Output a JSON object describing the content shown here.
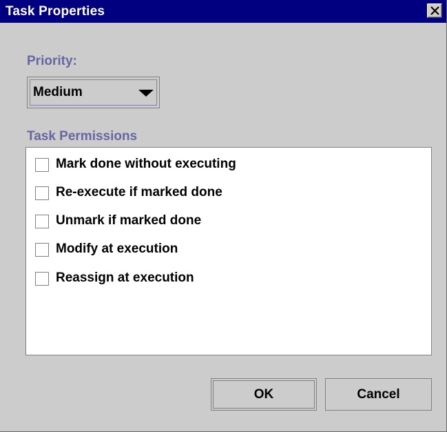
{
  "window": {
    "title": "Task Properties",
    "close_icon": "close-x-icon"
  },
  "priority": {
    "label": "Priority:",
    "selected": "Medium"
  },
  "permissions": {
    "label": "Task Permissions",
    "items": [
      {
        "label": "Mark done without executing",
        "checked": false
      },
      {
        "label": "Re-execute if marked done",
        "checked": false
      },
      {
        "label": "Unmark if marked done",
        "checked": false
      },
      {
        "label": "Modify at execution",
        "checked": false
      },
      {
        "label": "Reassign at execution",
        "checked": false
      }
    ]
  },
  "buttons": {
    "ok": "OK",
    "cancel": "Cancel"
  },
  "colors": {
    "titlebar": "#000080",
    "section_label": "#6666a3",
    "dialog_bg": "#cccccc"
  }
}
